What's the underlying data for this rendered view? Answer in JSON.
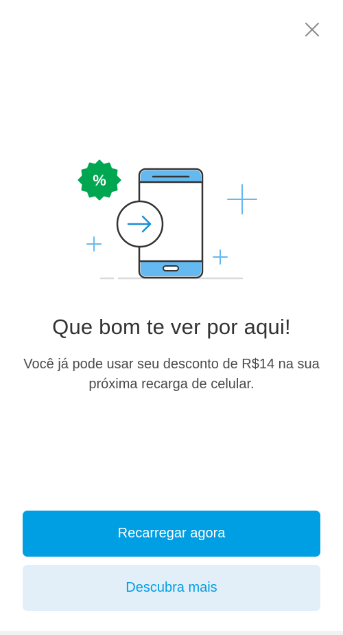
{
  "screen": {
    "title": "Que bom te ver por aqui!",
    "message": "Você já pode usar seu desconto de R$14 na sua próxima recarga de celular."
  },
  "illustration": {
    "badge_text": "%",
    "icons": [
      "close-icon",
      "percent-badge-icon",
      "smartphone-icon",
      "arrow-right-icon",
      "sparkle-icon"
    ]
  },
  "actions": {
    "primary_label": "Recarregar agora",
    "secondary_label": "Descubra mais"
  },
  "colors": {
    "brand_blue": "#009ee3",
    "light_blue": "#e3eff8",
    "screen_blue": "#64b9f0",
    "badge_green": "#00a650",
    "text_dark": "#333333"
  }
}
